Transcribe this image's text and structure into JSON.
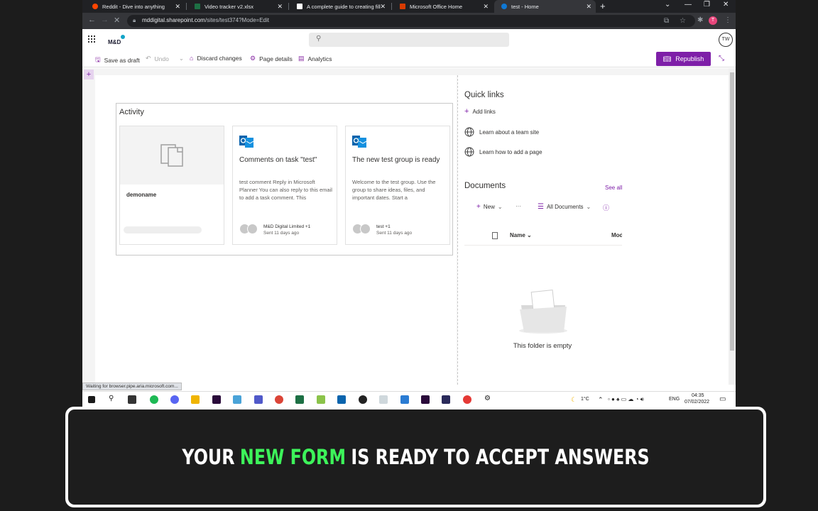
{
  "browser": {
    "tabs": [
      {
        "title": "Reddit - Dive into anything",
        "favicon_color": "#ff4500"
      },
      {
        "title": "Video tracker v2.xlsx",
        "favicon_color": "#1d7044"
      },
      {
        "title": "A complete guide to creating fill...",
        "favicon_color": "#ffffff"
      },
      {
        "title": "Microsoft Office Home",
        "favicon_color": "#d83b01"
      },
      {
        "title": "test - Home",
        "favicon_color": "#0f78d4"
      }
    ],
    "url_host": "mddigital.sharepoint.com",
    "url_path": "/sites/test374?Mode=Edit",
    "profile_initial": "T"
  },
  "sharepoint": {
    "logo_text": "M&D",
    "avatar_initials": "TW",
    "commands": {
      "save_as_draft": "Save as draft",
      "undo": "Undo",
      "discard_changes": "Discard changes",
      "page_details": "Page details",
      "analytics": "Analytics",
      "republish": "Republish"
    },
    "accent_color": "#7e1fa8"
  },
  "activity": {
    "title": "Activity",
    "cards": [
      {
        "type": "document",
        "name": "demoname"
      },
      {
        "type": "outlook",
        "title": "Comments on task \"test\"",
        "body": "test comment Reply in Microsoft Planner You can also reply to this email to add a task comment. This",
        "who": "M&D Digital Limited +1",
        "when": "Sent 11 days ago"
      },
      {
        "type": "outlook",
        "title": "The new test group is ready",
        "body": "Welcome to the test group. Use the group to share ideas, files, and important dates. Start a",
        "who": "test +1",
        "when": "Sent 11 days ago"
      }
    ]
  },
  "quick_links": {
    "title": "Quick links",
    "add_label": "Add links",
    "items": [
      "Learn about a team site",
      "Learn how to add a page"
    ]
  },
  "documents": {
    "title": "Documents",
    "see_all": "See all",
    "new_label": "New",
    "view_label": "All Documents",
    "col_name": "Name",
    "col_modified": "Modified",
    "empty_text": "This folder is empty"
  },
  "status_text": "Waiting for browser.pipe.aria.microsoft.com...",
  "taskbar": {
    "weather": "1°C",
    "lang": "ENG",
    "time": "04:35",
    "date": "07/02/2022"
  },
  "caption": {
    "before": "YOUR",
    "highlight": "NEW FORM",
    "after": "IS READY TO ACCEPT ANSWERS",
    "highlight_color": "#3df35a"
  }
}
